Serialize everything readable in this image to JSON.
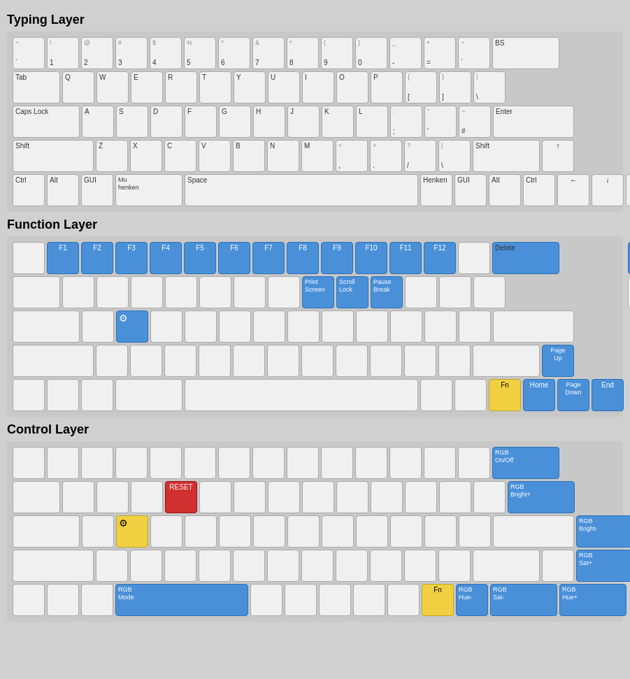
{
  "sections": [
    {
      "title": "Typing Layer",
      "id": "typing"
    },
    {
      "title": "Function Layer",
      "id": "function"
    },
    {
      "title": "Control Layer",
      "id": "control"
    }
  ]
}
